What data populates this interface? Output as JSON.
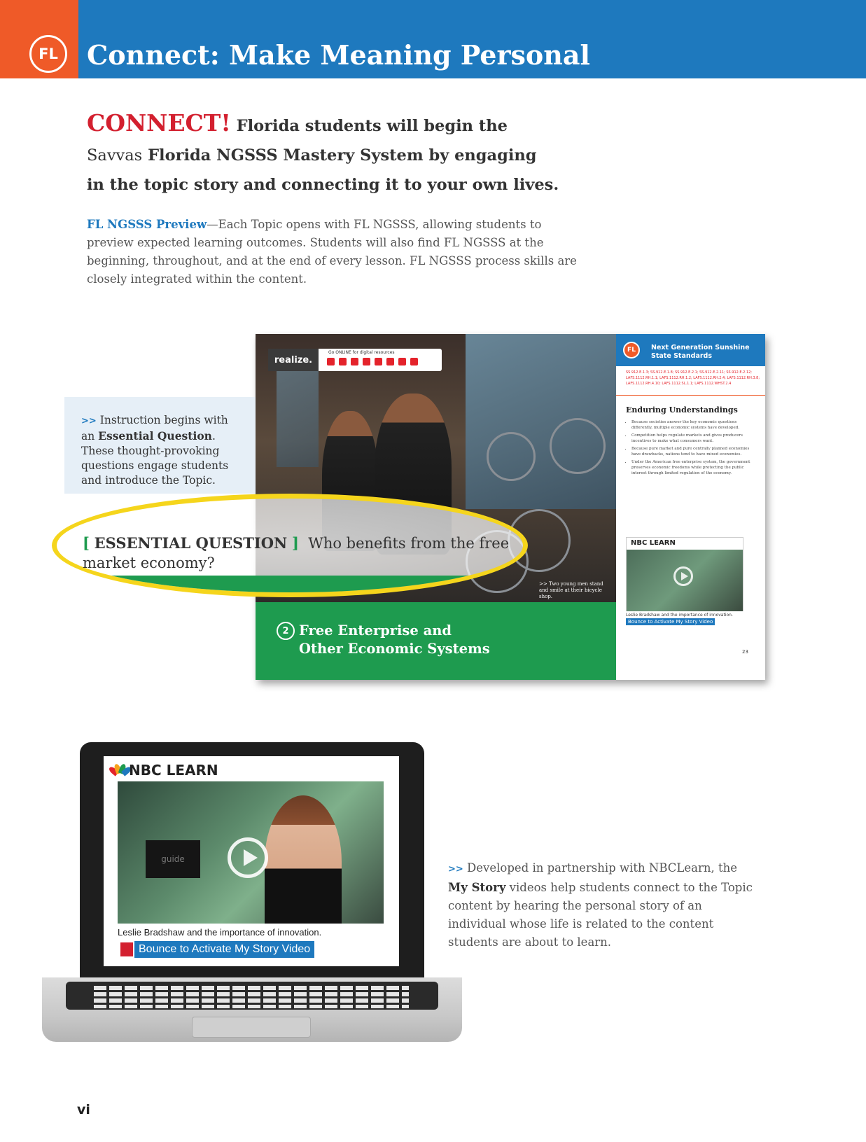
{
  "header": {
    "badge": "FL",
    "title": "Connect: Make Meaning Personal",
    "colors": {
      "orange": "#ef5a28",
      "blue": "#1e79be"
    }
  },
  "intro": {
    "kicker": "CONNECT!",
    "line1_rest": "Florida students will begin the",
    "brand": "Savvas",
    "line2_rest": "Florida NGSSS Mastery System by engaging",
    "line3": "in the topic story and connecting it to your own lives."
  },
  "preview": {
    "lead": "FL NGSSS Preview",
    "body": "—Each Topic opens with FL NGSSS, allowing students to preview expected learning outcomes. Students will also find FL NGSSS at the beginning, throughout, and at the end of every lesson. FL NGSSS process skills are closely integrated within the content."
  },
  "callout_left": {
    "arrows": ">>",
    "pre": " Instruction begins with an ",
    "bold": "Essential Question",
    "post": ". These thought-provoking questions engage students and introduce the Topic."
  },
  "essential_question": {
    "bracket_open": "[",
    "label": "ESSENTIAL QUESTION",
    "bracket_close": "]",
    "question": "Who benefits from the free market economy?"
  },
  "spread": {
    "realize_logo": "realize.",
    "go_online": "Go ONLINE for digital resources",
    "photo_caption": ">> Two young men stand and smile at their bicycle shop.",
    "chapter_number": "2",
    "chapter_title_1": "Free Enterprise and",
    "chapter_title_2": "Other Economic Systems",
    "right_page": {
      "badge": "FL",
      "title": "Next Generation Sunshine State Standards",
      "standards": "SS.912.E.1.3; SS.912.E.1.8; SS.912.E.2.1; SS.912.E.2.11; SS.912.E.2.12; LAFS.1112.RH.1.1; LAFS.1112.RH.1.2; LAFS.1112.RH.2.4; LAFS.1112.RH.3.8; LAFS.1112.RH.4.10; LAFS.1112.SL.1.1; LAFS.1112.WHST.2.4",
      "eu_title": "Enduring Understandings",
      "eu_items": [
        "Because societies answer the key economic questions differently, multiple economic systems have developed.",
        "Competition helps regulate markets and gives producers incentives to make what consumers want.",
        "Because pure market and pure centrally planned economies have drawbacks, nations tend to have mixed economies.",
        "Under the American free enterprise system, the government preserves economic freedoms while protecting the public interest through limited regulation of the economy."
      ],
      "video_brand": "NBC LEARN",
      "video_caption": "Leslie Bradshaw and the importance of innovation.",
      "bounce": "Bounce to Activate My Story Video",
      "page_number": "23"
    }
  },
  "laptop": {
    "brand": "NBC LEARN",
    "monitor_text": "guide",
    "caption": "Leslie Bradshaw and the importance of innovation.",
    "bounce": "Bounce to Activate My Story Video"
  },
  "callout_right": {
    "arrows": ">>",
    "pre": " Developed in partnership with NBCLearn, the ",
    "bold": "My Story",
    "post": " videos help students connect to the Topic content by hearing the personal story of an individual whose life is related to the content students are about to learn."
  },
  "footer": {
    "page_number": "vi"
  }
}
